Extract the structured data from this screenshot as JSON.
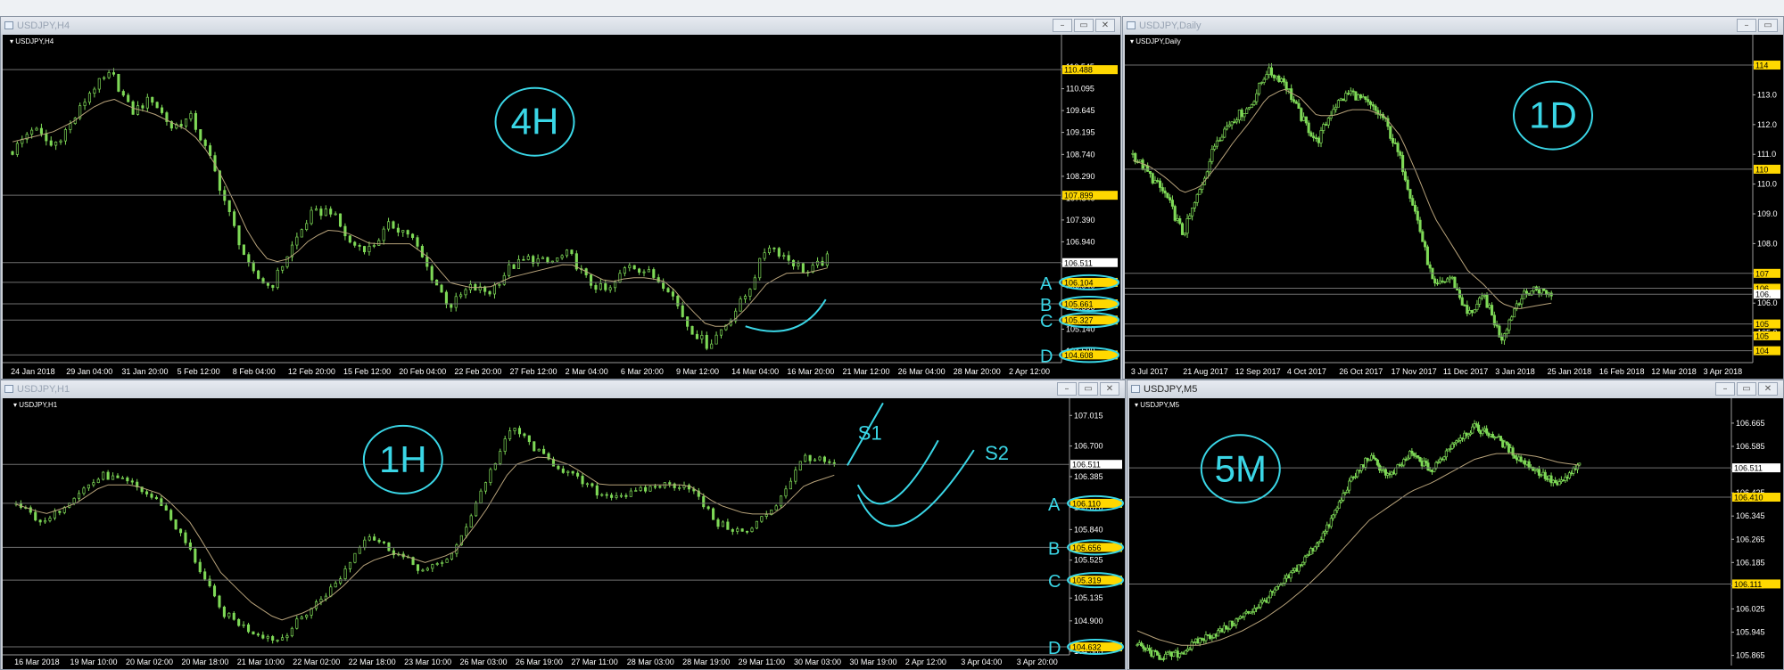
{
  "colors": {
    "background": "#000000",
    "candle": "#7ed957",
    "ma": "#b7a27a",
    "level": "#6f6f6f",
    "label_bg": "#ffd800",
    "price_tag": "#ffffff",
    "annotation": "#3ad6e6"
  },
  "windows": [
    {
      "id": "h4",
      "title": "USDJPY,H4",
      "active": false,
      "chart_data": {
        "type": "candlestick",
        "symbol_label": "USDJPY,H4",
        "ylim": [
          104.45,
          110.95
        ],
        "x_labels": [
          "24 Jan 2018",
          "29 Jan 04:00",
          "31 Jan 20:00",
          "5 Feb 12:00",
          "8 Feb 04:00",
          "12 Feb 20:00",
          "15 Feb 12:00",
          "20 Feb 04:00",
          "22 Feb 20:00",
          "27 Feb 12:00",
          "2 Mar 04:00",
          "6 Mar 20:00",
          "9 Mar 12:00",
          "14 Mar 04:00",
          "16 Mar 20:00",
          "21 Mar 12:00",
          "26 Mar 04:00",
          "28 Mar 20:00",
          "2 Apr 12:00"
        ],
        "y_ticks": [
          110.545,
          110.095,
          109.645,
          109.195,
          108.74,
          108.29,
          107.84,
          107.39,
          106.94,
          106.49,
          106.04,
          105.59,
          105.14,
          104.69
        ],
        "levels": [
          {
            "value": 110.488,
            "label": "110.488",
            "style": "yellow"
          },
          {
            "value": 107.899,
            "label": "107.899",
            "style": "yellow"
          },
          {
            "value": 106.511,
            "label": "106.511",
            "style": "white"
          },
          {
            "value": 106.104,
            "label": "106.104",
            "style": "yellow"
          },
          {
            "value": 105.661,
            "label": "105.661",
            "style": "yellow"
          },
          {
            "value": 105.327,
            "label": "105.327",
            "style": "yellow"
          },
          {
            "value": 104.608,
            "label": "104.608",
            "style": "yellow"
          }
        ],
        "close_path": [
          108.8,
          109.3,
          108.9,
          109.4,
          110.1,
          110.4,
          109.6,
          109.9,
          109.3,
          109.5,
          108.6,
          107.4,
          106.3,
          106.0,
          106.8,
          107.5,
          107.6,
          106.9,
          106.8,
          107.3,
          107.1,
          106.3,
          105.6,
          106.0,
          105.9,
          106.4,
          106.6,
          106.5,
          106.7,
          106.1,
          105.9,
          106.5,
          106.3,
          106.0,
          105.2,
          104.8,
          105.3,
          105.9,
          106.9,
          106.6,
          106.3,
          106.6
        ],
        "ma_path": [
          109.0,
          109.1,
          109.2,
          109.4,
          109.7,
          109.9,
          109.7,
          109.6,
          109.4,
          109.2,
          108.7,
          107.9,
          107.0,
          106.5,
          106.6,
          107.0,
          107.2,
          107.1,
          106.9,
          106.9,
          106.9,
          106.6,
          106.1,
          106.0,
          106.0,
          106.2,
          106.3,
          106.4,
          106.5,
          106.3,
          106.1,
          106.2,
          106.2,
          106.1,
          105.6,
          105.2,
          105.2,
          105.6,
          106.1,
          106.3,
          106.3,
          106.4
        ],
        "annotations": [
          "4H",
          "D",
          "C",
          "B",
          "A"
        ]
      }
    },
    {
      "id": "daily",
      "title": "USDJPY,Daily",
      "active": false,
      "chart_data": {
        "type": "candlestick",
        "symbol_label": "USDJPY,Daily",
        "ylim": [
          104.0,
          114.6
        ],
        "x_labels": [
          "3 Jul 2017",
          "21 Aug 2017",
          "12 Sep 2017",
          "4 Oct 2017",
          "26 Oct 2017",
          "17 Nov 2017",
          "11 Dec 2017",
          "3 Jan 2018",
          "25 Jan 2018",
          "16 Feb 2018",
          "12 Mar 2018",
          "3 Apr 2018"
        ],
        "y_ticks": [
          114.0,
          113.0,
          112.0,
          111.0,
          110.0,
          109.0,
          108.0,
          107.0,
          106.0,
          105.0
        ],
        "levels": [
          {
            "value": 114.0,
            "label": "114",
            "style": "yellow"
          },
          {
            "value": 110.5,
            "label": "110",
            "style": "yellow"
          },
          {
            "value": 107.0,
            "label": "107",
            "style": "yellow"
          },
          {
            "value": 106.5,
            "label": "106",
            "style": "yellow"
          },
          {
            "value": 106.3,
            "label": "106.",
            "style": "white"
          },
          {
            "value": 105.3,
            "label": "105",
            "style": "yellow"
          },
          {
            "value": 104.9,
            "label": "105",
            "style": "yellow"
          },
          {
            "value": 104.4,
            "label": "104",
            "style": "yellow"
          }
        ],
        "close_path": [
          111.0,
          110.3,
          109.6,
          108.3,
          109.8,
          111.5,
          112.2,
          112.6,
          113.8,
          113.5,
          112.3,
          111.4,
          112.6,
          113.1,
          112.7,
          112.2,
          110.8,
          108.8,
          106.5,
          106.9,
          105.6,
          106.2,
          104.8,
          106.1,
          106.5,
          106.3
        ],
        "ma_path": [
          110.8,
          110.6,
          110.2,
          109.7,
          109.9,
          110.6,
          111.4,
          112.1,
          112.9,
          113.2,
          112.9,
          112.3,
          112.3,
          112.5,
          112.5,
          112.3,
          111.6,
          110.3,
          108.9,
          108.0,
          107.1,
          106.6,
          106.0,
          105.8,
          105.9,
          106.0
        ],
        "annotations": [
          "1D"
        ]
      }
    },
    {
      "id": "h1",
      "title": "USDJPY,H1",
      "active": false,
      "chart_data": {
        "type": "candlestick",
        "symbol_label": "USDJPY,H1",
        "ylim": [
          104.55,
          107.1
        ],
        "x_labels": [
          "16 Mar 2018",
          "19 Mar 10:00",
          "20 Mar 02:00",
          "20 Mar 18:00",
          "21 Mar 10:00",
          "22 Mar 02:00",
          "22 Mar 18:00",
          "23 Mar 10:00",
          "26 Mar 03:00",
          "26 Mar 19:00",
          "27 Mar 11:00",
          "28 Mar 03:00",
          "28 Mar 19:00",
          "29 Mar 11:00",
          "30 Mar 03:00",
          "30 Mar 19:00",
          "2 Apr 12:00",
          "3 Apr 04:00",
          "3 Apr 20:00"
        ],
        "y_ticks": [
          107.015,
          106.7,
          106.385,
          106.07,
          105.84,
          105.525,
          105.135,
          104.9,
          104.585
        ],
        "levels": [
          {
            "value": 106.511,
            "label": "106.511",
            "style": "white"
          },
          {
            "value": 106.11,
            "label": "106.110",
            "style": "yellow"
          },
          {
            "value": 105.656,
            "label": "105.656",
            "style": "yellow"
          },
          {
            "value": 105.319,
            "label": "105.319",
            "style": "yellow"
          },
          {
            "value": 104.632,
            "label": "104.632",
            "style": "yellow"
          }
        ],
        "close_path": [
          106.1,
          105.9,
          106.2,
          106.4,
          106.3,
          106.1,
          105.6,
          105.0,
          104.8,
          104.7,
          105.0,
          105.3,
          105.8,
          105.6,
          105.4,
          105.6,
          106.3,
          106.9,
          106.6,
          106.4,
          106.2,
          106.2,
          106.3,
          106.3,
          105.9,
          105.8,
          106.1,
          106.6,
          106.5
        ],
        "ma_path": [
          106.1,
          106.0,
          106.1,
          106.3,
          106.3,
          106.2,
          105.9,
          105.4,
          105.1,
          104.9,
          105.0,
          105.2,
          105.5,
          105.6,
          105.5,
          105.6,
          106.0,
          106.5,
          106.6,
          106.5,
          106.3,
          106.3,
          106.3,
          106.3,
          106.1,
          106.0,
          106.0,
          106.3,
          106.4
        ],
        "annotations": [
          "1H",
          "S1",
          "S2",
          "D",
          "C",
          "B",
          "A"
        ]
      }
    },
    {
      "id": "m5",
      "title": "USDJPY,M5",
      "active": true,
      "chart_data": {
        "type": "candlestick",
        "symbol_label": "USDJPY,M5",
        "ylim": [
          105.83,
          106.72
        ],
        "x_labels": [],
        "y_ticks": [
          106.665,
          106.585,
          106.505,
          106.425,
          106.345,
          106.265,
          106.185,
          106.105,
          106.025,
          105.945,
          105.865
        ],
        "levels": [
          {
            "value": 106.511,
            "label": "106.511",
            "style": "white"
          },
          {
            "value": 106.41,
            "label": "106.410",
            "style": "yellow"
          },
          {
            "value": 106.111,
            "label": "106.111",
            "style": "yellow"
          }
        ],
        "close_path": [
          105.9,
          105.86,
          105.87,
          105.92,
          105.95,
          106.0,
          106.05,
          106.12,
          106.2,
          106.3,
          106.45,
          106.55,
          106.48,
          106.56,
          106.5,
          106.6,
          106.65,
          106.62,
          106.55,
          106.5,
          106.45,
          106.52
        ],
        "ma_path": [
          105.95,
          105.92,
          105.9,
          105.9,
          105.92,
          105.95,
          105.99,
          106.04,
          106.1,
          106.17,
          106.25,
          106.33,
          106.38,
          106.43,
          106.46,
          106.5,
          106.54,
          106.56,
          106.56,
          106.55,
          106.53,
          106.52
        ],
        "annotations": [
          "5M"
        ]
      }
    }
  ]
}
